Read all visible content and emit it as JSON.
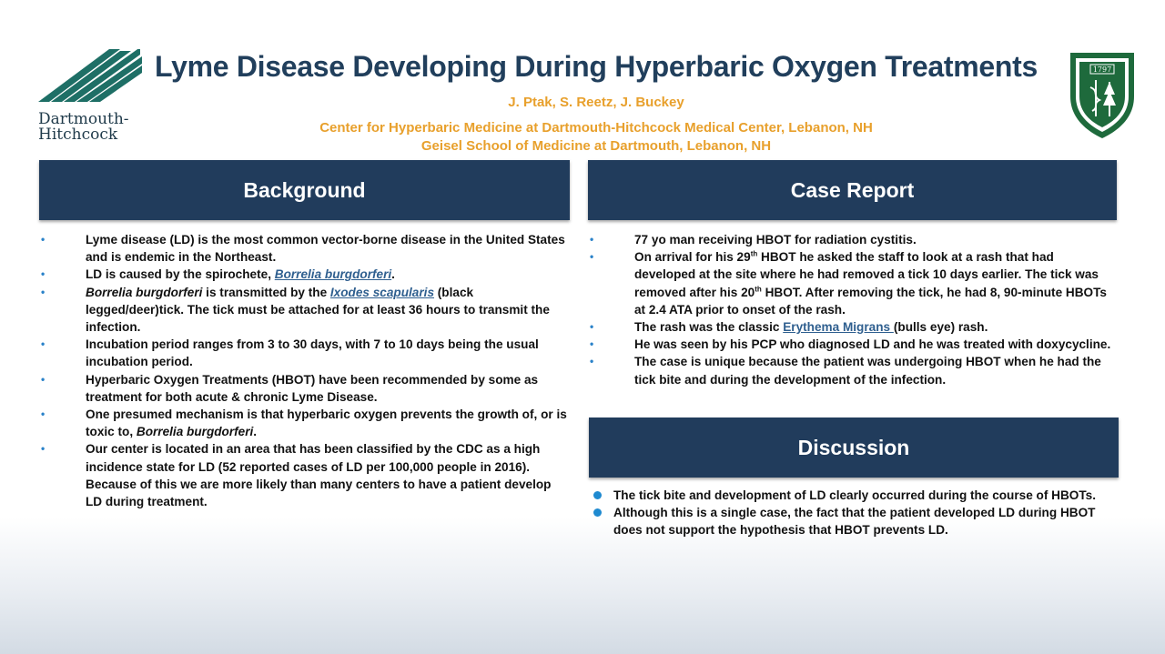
{
  "header": {
    "title": "Lyme Disease Developing During Hyperbaric Oxygen Treatments",
    "authors": "J. Ptak, S. Reetz, J. Buckey",
    "affiliation_1": "Center for Hyperbaric Medicine at Dartmouth-Hitchcock Medical Center, Lebanon, NH",
    "affiliation_2": "Geisel School of Medicine at Dartmouth, Lebanon, NH",
    "logo_left_line1": "Dartmouth-",
    "logo_left_line2": "Hitchcock",
    "logo_right_year": "1797"
  },
  "background": {
    "heading": "Background",
    "items": [
      {
        "parts": [
          "Lyme disease (LD) is the most common vector-borne disease in the United States and is endemic in the Northeast."
        ]
      },
      {
        "parts": [
          "LD is caused by the spirochete, ",
          "Borrelia burgdorferi",
          "."
        ]
      },
      {
        "parts": [
          "Borrelia burgdorferi",
          " is transmitted by the ",
          "Ixodes scapularis",
          " (black legged/deer)tick.  The tick must be attached for at least 36 hours to transmit the infection."
        ]
      },
      {
        "parts": [
          "Incubation period ranges from 3 to 30 days, with 7 to 10 days being the usual incubation period."
        ]
      },
      {
        "parts": [
          "Hyperbaric Oxygen Treatments (HBOT) have been recommended by some as treatment for both acute & chronic Lyme Disease."
        ]
      },
      {
        "parts": [
          "One presumed mechanism is that hyperbaric oxygen prevents the growth of, or is toxic to,  ",
          "Borrelia burgdorferi",
          "."
        ]
      },
      {
        "parts": [
          "Our center is located in an area that has been classified by the CDC as a high incidence state for LD (52 reported cases of LD per 100,000 people in 2016). Because of this we are more likely than many centers to have a patient develop LD during treatment."
        ]
      }
    ]
  },
  "case_report": {
    "heading": "Case Report",
    "items": [
      {
        "parts": [
          "77 yo man receiving HBOT for  radiation cystitis."
        ]
      },
      {
        "parts": [
          "On arrival for his 29",
          "th",
          " HBOT he asked the staff to look at a rash that had developed at the site where he had removed a tick 10 days earlier. The tick was removed after his 20",
          "th",
          " HBOT. After removing the tick, he had 8, 90-minute HBOTs at 2.4 ATA prior to onset of  the rash."
        ]
      },
      {
        "parts": [
          "The rash was the classic ",
          "Erythema Migrans ",
          "(bulls eye) rash."
        ]
      },
      {
        "parts": [
          "He was seen by his PCP who diagnosed LD and he was treated with doxycycline."
        ]
      },
      {
        "parts": [
          "The case is unique because the patient was undergoing HBOT when he had the tick bite and during the development of the infection."
        ]
      }
    ]
  },
  "discussion": {
    "heading": "Discussion",
    "items": [
      "The tick bite and development of LD clearly occurred during the course of HBOTs.",
      "Although this is a single case, the fact that the patient developed LD during HBOT does not support the hypothesis that HBOT prevents LD."
    ]
  },
  "colors": {
    "title": "#213f5c",
    "accent_orange": "#e8a02c",
    "section_header_bg": "#213c5c",
    "bullet_blue": "#2a82c9",
    "link": "#2f5f8f"
  }
}
